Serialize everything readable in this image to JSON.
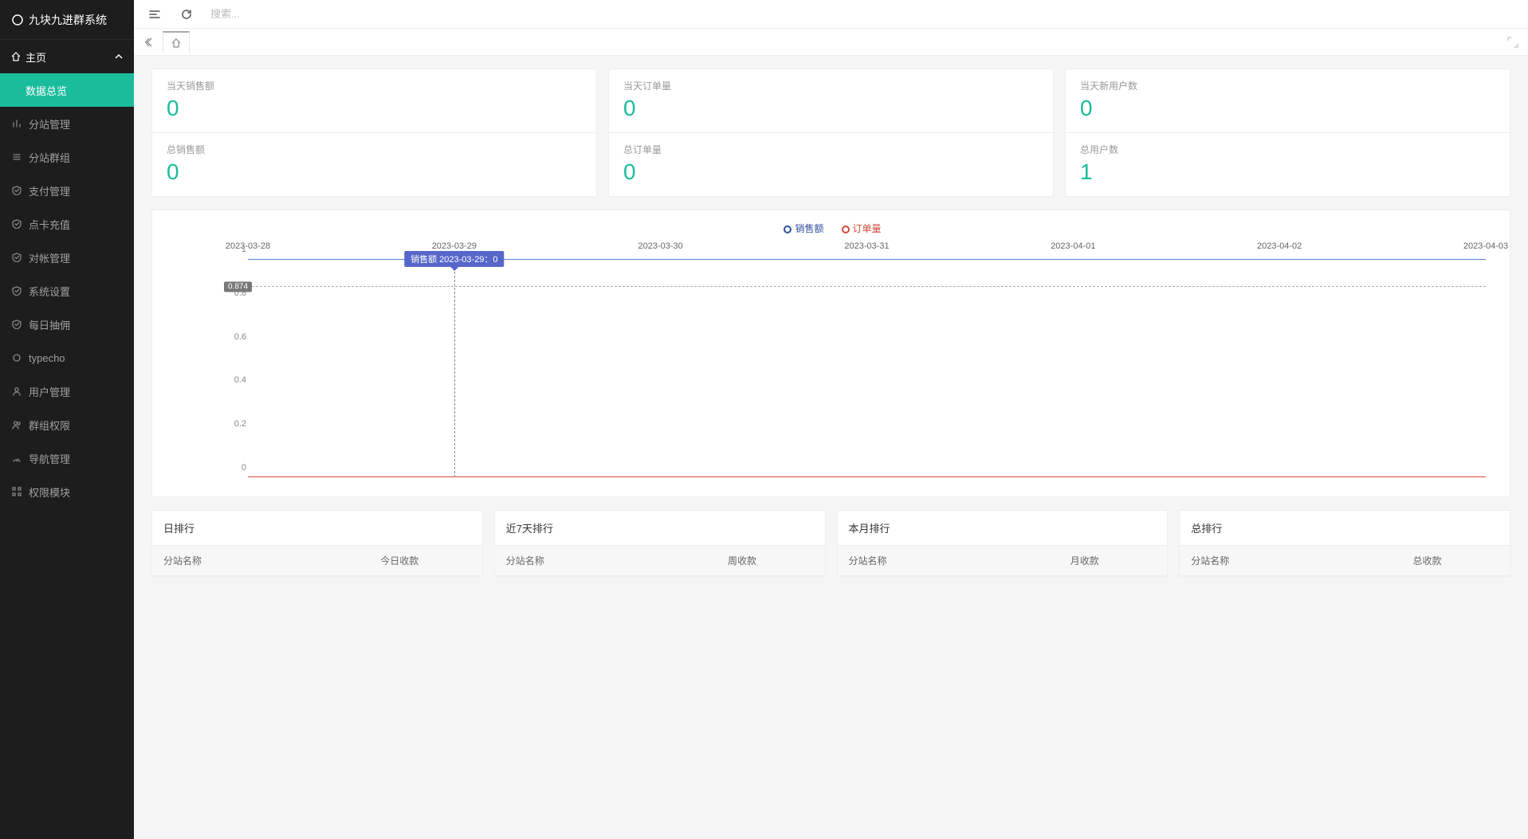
{
  "brand": "九块九进群系统",
  "search": {
    "placeholder": "搜索..."
  },
  "nav": {
    "header": "主页",
    "items": [
      {
        "label": "数据总览",
        "icon": "dashboard-icon",
        "active": true
      },
      {
        "label": "分站管理",
        "icon": "bar-chart-icon"
      },
      {
        "label": "分站群组",
        "icon": "list-icon"
      },
      {
        "label": "支付管理",
        "icon": "shield-check-icon"
      },
      {
        "label": "点卡充值",
        "icon": "shield-check-icon"
      },
      {
        "label": "对帐管理",
        "icon": "shield-check-icon"
      },
      {
        "label": "系统设置",
        "icon": "shield-check-icon"
      },
      {
        "label": "每日抽佣",
        "icon": "shield-check-icon"
      },
      {
        "label": "typecho",
        "icon": "spinner-icon"
      },
      {
        "label": "用户管理",
        "icon": "user-icon"
      },
      {
        "label": "群组权限",
        "icon": "users-icon"
      },
      {
        "label": "导航管理",
        "icon": "gauge-icon"
      },
      {
        "label": "权限模块",
        "icon": "grid-icon"
      }
    ]
  },
  "stats": [
    [
      {
        "label": "当天销售额",
        "value": "0"
      },
      {
        "label": "总销售额",
        "value": "0"
      }
    ],
    [
      {
        "label": "当天订单量",
        "value": "0"
      },
      {
        "label": "总订单量",
        "value": "0"
      }
    ],
    [
      {
        "label": "当天新用户数",
        "value": "0"
      },
      {
        "label": "总用户数",
        "value": "1"
      }
    ]
  ],
  "chart_data": {
    "type": "line",
    "categories": [
      "2023-03-28",
      "2023-03-29",
      "2023-03-30",
      "2023-03-31",
      "2023-04-01",
      "2023-04-02",
      "2023-04-03"
    ],
    "series": [
      {
        "name": "销售额",
        "values": [
          0,
          0,
          0,
          0,
          0,
          0,
          0
        ],
        "color": "#5a7dd6"
      },
      {
        "name": "订单量",
        "values": [
          0,
          0,
          0,
          0,
          0,
          0,
          0
        ],
        "color": "#d24a3a"
      }
    ],
    "ylim": [
      0,
      1
    ],
    "yticks": [
      0,
      0.2,
      0.4,
      0.6,
      0.8,
      1
    ],
    "tooltip": {
      "series": "销售额",
      "category": "2023-03-29",
      "value": 0,
      "text": "销售额  2023-03-29：0"
    },
    "guide": {
      "value": 0.874,
      "label": "0.874"
    }
  },
  "rankings": [
    {
      "title": "日排行",
      "col1": "分站名称",
      "col2": "今日收款"
    },
    {
      "title": "近7天排行",
      "col1": "分站名称",
      "col2": "周收款"
    },
    {
      "title": "本月排行",
      "col1": "分站名称",
      "col2": "月收款"
    },
    {
      "title": "总排行",
      "col1": "分站名称",
      "col2": "总收款"
    }
  ]
}
